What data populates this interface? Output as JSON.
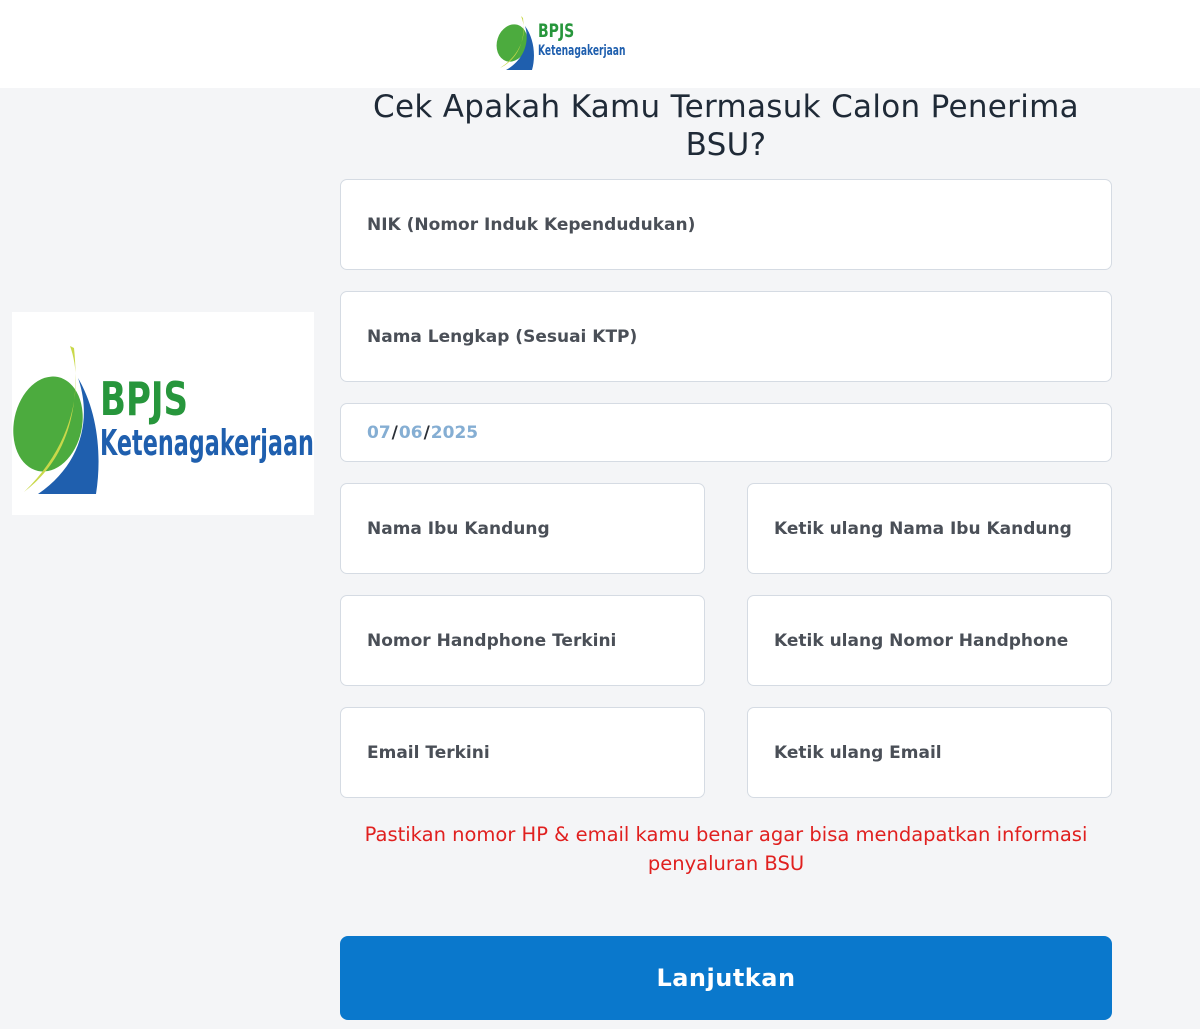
{
  "brand": {
    "name_line1": "BPJS",
    "name_line2": "Ketenagakerjaan",
    "green": "#27963c",
    "blue": "#1f5fae",
    "icon": "bpjs-leaf-logo"
  },
  "heading": {
    "title": "Cek Apakah Kamu Termasuk Calon Penerima BSU?"
  },
  "form": {
    "nik": {
      "placeholder": "NIK (Nomor Induk Kependudukan)"
    },
    "full_name": {
      "placeholder": "Nama Lengkap (Sesuai KTP)"
    },
    "birth_date": {
      "day": "07",
      "month": "06",
      "year": "2025",
      "sep": "/"
    },
    "mother_name": {
      "placeholder": "Nama Ibu Kandung"
    },
    "mother_name_confirm": {
      "placeholder": "Ketik ulang Nama Ibu Kandung"
    },
    "phone": {
      "placeholder": "Nomor Handphone Terkini"
    },
    "phone_confirm": {
      "placeholder": "Ketik ulang Nomor Handphone"
    },
    "email": {
      "placeholder": "Email Terkini"
    },
    "email_confirm": {
      "placeholder": "Ketik ulang Email"
    }
  },
  "notice": {
    "text": "Pastikan nomor HP & email kamu benar agar bisa mendapatkan informasi penyaluran BSU",
    "color": "#e0201f"
  },
  "submit": {
    "label": "Lanjutkan",
    "color": "#0a78cc"
  }
}
